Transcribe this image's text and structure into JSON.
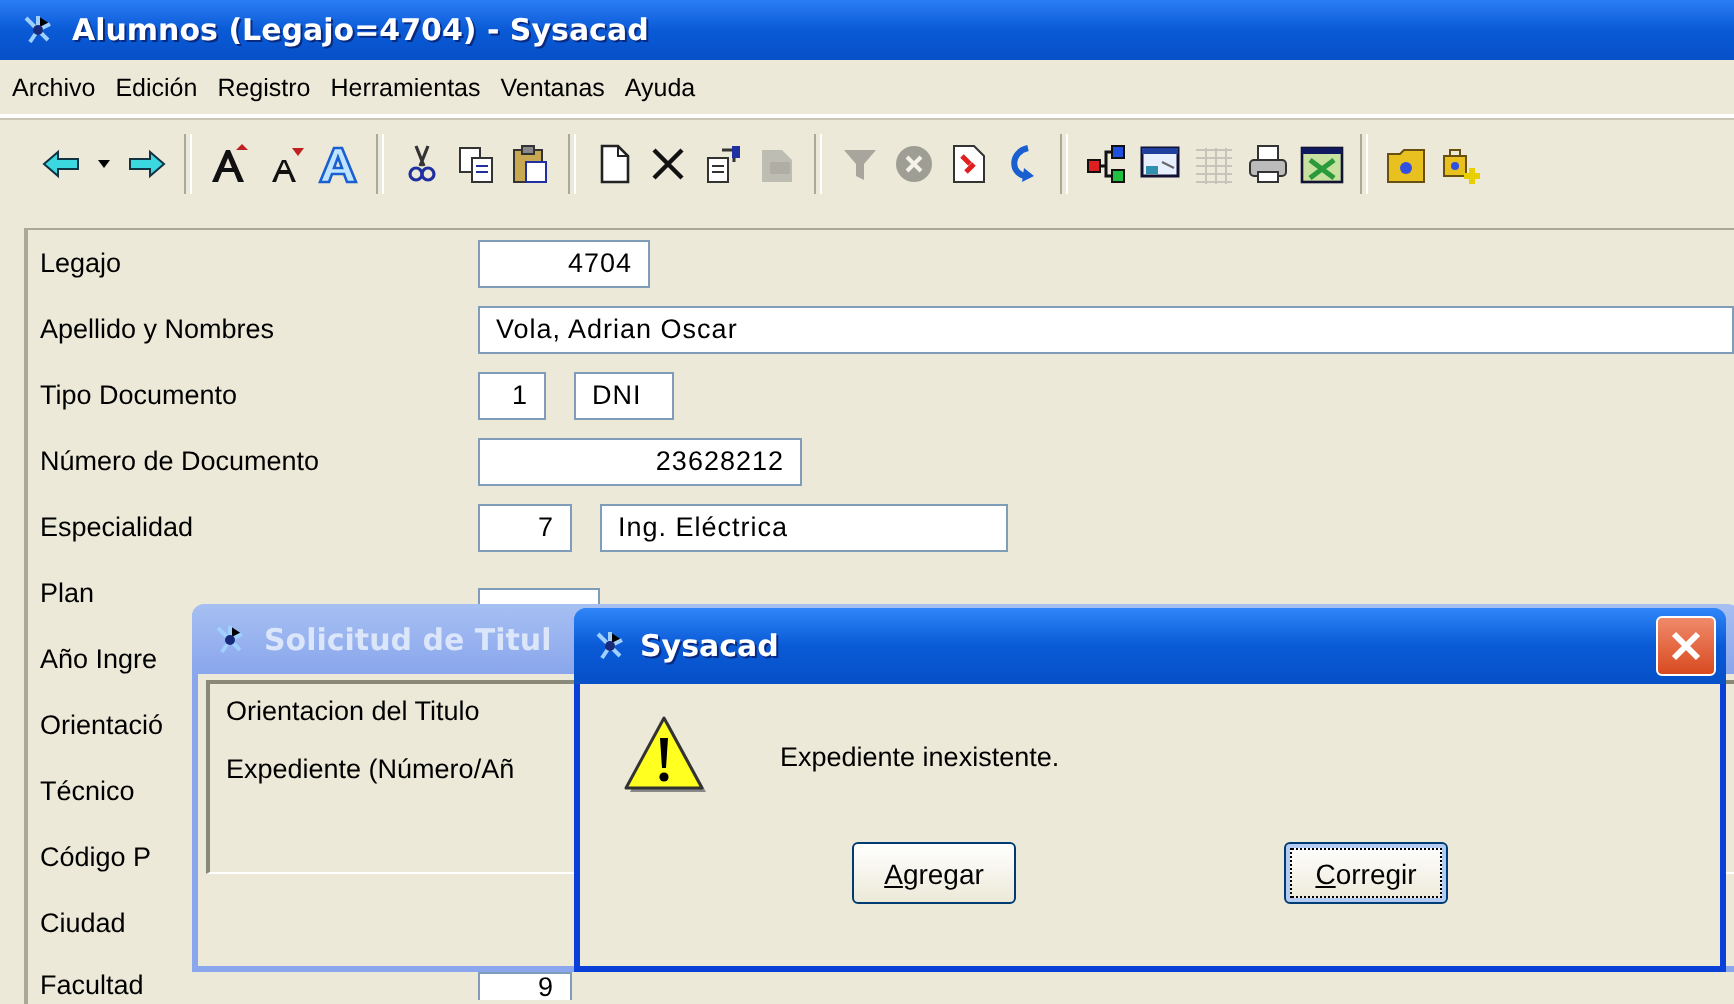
{
  "window": {
    "title": "Alumnos (Legajo=4704) - Sysacad"
  },
  "menu": [
    "Archivo",
    "Edición",
    "Registro",
    "Herramientas",
    "Ventanas",
    "Ayuda"
  ],
  "toolbar": [
    [
      {
        "disabled": false
      },
      {
        "disabled": false
      },
      {
        "disabled": false
      }
    ],
    [
      {
        "disabled": false
      },
      {
        "disabled": false
      },
      {
        "disabled": false
      }
    ],
    [
      {
        "disabled": false
      },
      {
        "disabled": false
      },
      {
        "disabled": false
      }
    ],
    [
      {
        "disabled": false
      },
      {
        "disabled": false
      },
      {
        "disabled": false
      },
      {
        "disabled": true
      }
    ],
    [
      {
        "disabled": true
      },
      {
        "disabled": true
      },
      {
        "disabled": false
      },
      {
        "disabled": false
      }
    ],
    [
      {
        "disabled": false
      },
      {
        "disabled": false
      },
      {
        "disabled": true
      },
      {
        "disabled": false
      },
      {
        "disabled": false
      }
    ],
    [
      {
        "disabled": false
      },
      {
        "disabled": false
      }
    ]
  ],
  "form": [
    {
      "label": "Legajo",
      "kind": "code",
      "value": "4704"
    },
    {
      "label": "Apellido y Nombres",
      "kind": "text",
      "value": "Vola, Adrian Oscar"
    },
    {
      "label": "Tipo Documento",
      "kind": "code-desc",
      "value": "1",
      "description": "DNI"
    },
    {
      "label": "Número de Documento",
      "kind": "code",
      "value": "23628212"
    },
    {
      "label": "Especialidad",
      "kind": "code-desc",
      "value": "7",
      "description": "Ing. Eléctrica"
    },
    {
      "label": "Plan",
      "kind": "empty"
    },
    {
      "label": "Año Ingre",
      "kind": "none"
    },
    {
      "label": "Orientació",
      "kind": "none"
    },
    {
      "label": "Técnico",
      "kind": "none"
    },
    {
      "label": "Código P",
      "kind": "none"
    },
    {
      "label": "Ciudad",
      "kind": "none"
    },
    {
      "label": "Facultad",
      "kind": "code",
      "value": "9"
    }
  ],
  "background_window": {
    "title": "Solicitud de Titul",
    "labels": [
      "Orientacion del Titulo",
      "Expediente (Número/Añ"
    ]
  },
  "message_box": {
    "title": "Sysacad",
    "message": "Expediente inexistente.",
    "buttons": [
      {
        "label": "Agregar",
        "focused": false
      },
      {
        "label": "Corregir",
        "focused": true
      }
    ]
  }
}
